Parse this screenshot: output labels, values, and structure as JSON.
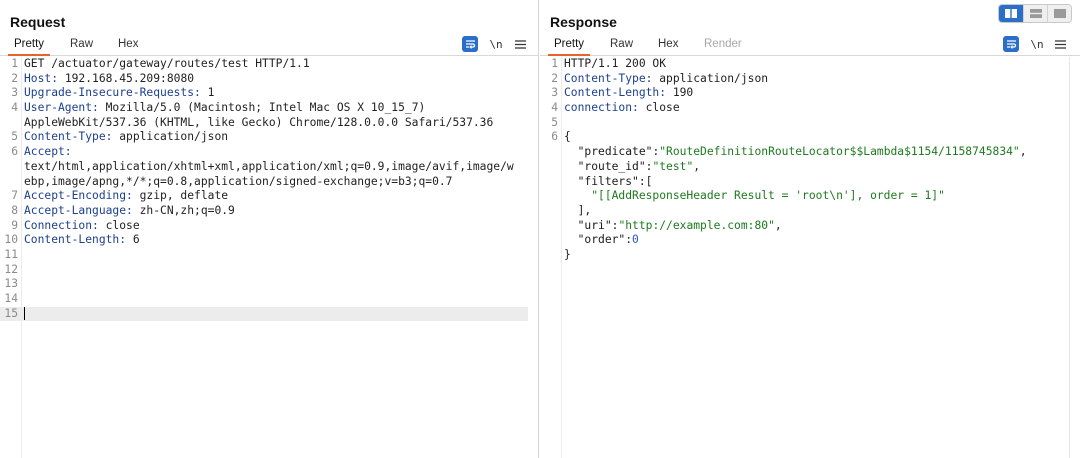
{
  "request": {
    "title": "Request",
    "tabs": [
      "Pretty",
      "Raw",
      "Hex"
    ],
    "active_tab": "Pretty",
    "tools": {
      "wrap_icon": "wrap-lines-icon",
      "newline_label": "\\n",
      "menu_icon": "hamburger-menu-icon"
    },
    "lines": [
      {
        "n": "1",
        "text": "GET /actuator/gateway/routes/test HTTP/1.1"
      },
      {
        "n": "2",
        "key": "Host:",
        "value": " 192.168.45.209:8080"
      },
      {
        "n": "3",
        "key": "Upgrade-Insecure-Requests:",
        "value": " 1"
      },
      {
        "n": "4",
        "key": "User-Agent:",
        "value": " Mozilla/5.0 (Macintosh; Intel Mac OS X 10_15_7)"
      },
      {
        "n": "",
        "text": "AppleWebKit/537.36 (KHTML, like Gecko) Chrome/128.0.0.0 Safari/537.36"
      },
      {
        "n": "5",
        "key": "Content-Type:",
        "value": " application/json"
      },
      {
        "n": "6",
        "key": "Accept:",
        "value": ""
      },
      {
        "n": "",
        "text": "text/html,application/xhtml+xml,application/xml;q=0.9,image/avif,image/w"
      },
      {
        "n": "",
        "text": "ebp,image/apng,*/*;q=0.8,application/signed-exchange;v=b3;q=0.7"
      },
      {
        "n": "7",
        "key": "Accept-Encoding:",
        "value": " gzip, deflate"
      },
      {
        "n": "8",
        "key": "Accept-Language:",
        "value": " zh-CN,zh;q=0.9"
      },
      {
        "n": "9",
        "key": "Connection:",
        "value": " close"
      },
      {
        "n": "10",
        "key": "Content-Length:",
        "value": " 6"
      },
      {
        "n": "11",
        "text": ""
      },
      {
        "n": "12",
        "text": ""
      },
      {
        "n": "13",
        "text": ""
      },
      {
        "n": "14",
        "text": ""
      },
      {
        "n": "15",
        "text": "",
        "current": true
      }
    ]
  },
  "response": {
    "title": "Response",
    "tabs": [
      "Pretty",
      "Raw",
      "Hex",
      "Render"
    ],
    "active_tab": "Pretty",
    "disabled_tab": "Render",
    "tools": {
      "wrap_icon": "wrap-lines-icon",
      "newline_label": "\\n",
      "menu_icon": "hamburger-menu-icon"
    },
    "layout_icons": [
      "side-by-side-layout-icon",
      "stacked-layout-icon",
      "single-pane-layout-icon"
    ],
    "lines": [
      {
        "n": "1",
        "text": "HTTP/1.1 200 OK"
      },
      {
        "n": "2",
        "key": "Content-Type:",
        "value": " application/json"
      },
      {
        "n": "3",
        "key": "Content-Length:",
        "value": " 190"
      },
      {
        "n": "4",
        "key": "connection:",
        "value": " close"
      },
      {
        "n": "5",
        "text": ""
      },
      {
        "n": "6",
        "text": "{"
      },
      {
        "n": "",
        "indent": "  ",
        "jkey": "\"predicate\"",
        "sep": ":",
        "jstr": "\"RouteDefinitionRouteLocator$$Lambda$1154/1158745834\"",
        "tail": ","
      },
      {
        "n": "",
        "indent": "  ",
        "jkey": "\"route_id\"",
        "sep": ":",
        "jstr": "\"test\"",
        "tail": ","
      },
      {
        "n": "",
        "indent": "  ",
        "jkey": "\"filters\"",
        "sep": ":",
        "tail": "["
      },
      {
        "n": "",
        "indent": "    ",
        "jstr": "\"[[AddResponseHeader Result = 'root\\n'], order = 1]\""
      },
      {
        "n": "",
        "indent": "  ",
        "tail": "],"
      },
      {
        "n": "",
        "indent": "  ",
        "jkey": "\"uri\"",
        "sep": ":",
        "jstr": "\"http://example.com:80\"",
        "tail": ","
      },
      {
        "n": "",
        "indent": "  ",
        "jkey": "\"order\"",
        "sep": ":",
        "jnum": "0"
      },
      {
        "n": "",
        "text": "}"
      }
    ]
  }
}
